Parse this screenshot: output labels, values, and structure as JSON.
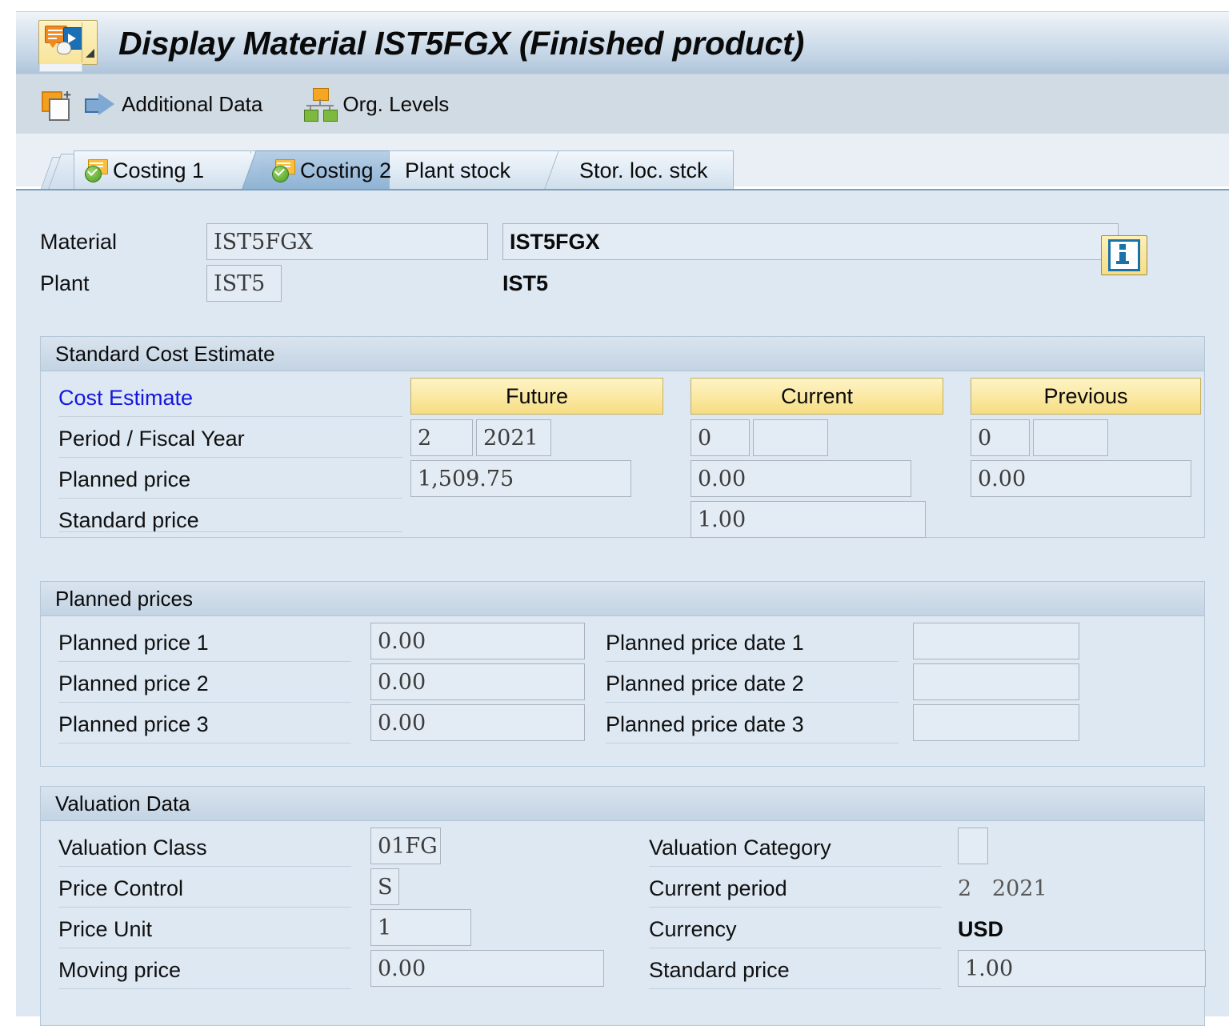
{
  "window": {
    "title": "Display Material IST5FGX (Finished product)",
    "title_icon": "material-display-icon"
  },
  "toolbar": {
    "items": [
      {
        "label": "Additional Data",
        "icon": "additional-data-icon"
      },
      {
        "label": "Org. Levels",
        "icon": "org-levels-icon"
      }
    ]
  },
  "tabs": [
    {
      "label": "Costing 1",
      "active": false,
      "icon": "costing-tab-icon"
    },
    {
      "label": "Costing 2",
      "active": true,
      "icon": "costing-tab-icon"
    },
    {
      "label": "Plant stock",
      "active": false,
      "icon": ""
    },
    {
      "label": "Stor. loc. stck",
      "active": false,
      "icon": ""
    }
  ],
  "header": {
    "material_label": "Material",
    "material_key": "IST5FGX",
    "material_desc": "IST5FGX",
    "plant_label": "Plant",
    "plant_key": "IST5",
    "plant_desc": "IST5",
    "info_icon": "info-icon"
  },
  "standard_cost_estimate": {
    "title": "Standard Cost Estimate",
    "cost_estimate_label": "Cost Estimate",
    "period_label": "Period / Fiscal Year",
    "planned_price_label": "Planned price",
    "standard_price_label": "Standard price",
    "columns": [
      {
        "header": "Future",
        "period": "2",
        "fiscal_year": "2021",
        "planned_price": "1,509.75",
        "standard_price": ""
      },
      {
        "header": "Current",
        "period": "0",
        "fiscal_year": "",
        "planned_price": "0.00",
        "standard_price": "1.00"
      },
      {
        "header": "Previous",
        "period": "0",
        "fiscal_year": "",
        "planned_price": "0.00",
        "standard_price": ""
      }
    ]
  },
  "planned_prices": {
    "title": "Planned prices",
    "rows": [
      {
        "label": "Planned price 1",
        "value": "0.00",
        "date_label": "Planned price date 1",
        "date_value": ""
      },
      {
        "label": "Planned price 2",
        "value": "0.00",
        "date_label": "Planned price date 2",
        "date_value": ""
      },
      {
        "label": "Planned price 3",
        "value": "0.00",
        "date_label": "Planned price date 3",
        "date_value": ""
      }
    ]
  },
  "valuation_data": {
    "title": "Valuation Data",
    "left": [
      {
        "label": "Valuation Class",
        "value": "01FG"
      },
      {
        "label": "Price Control",
        "value": "S"
      },
      {
        "label": "Price Unit",
        "value": "1"
      },
      {
        "label": "Moving price",
        "value": "0.00"
      }
    ],
    "right": [
      {
        "label": "Valuation Category",
        "value": ""
      },
      {
        "label": "Current period",
        "value": "2   2021"
      },
      {
        "label": "Currency",
        "value": "USD"
      },
      {
        "label": "Standard price",
        "value": "1.00"
      }
    ]
  },
  "colors": {
    "title_bar_top": "#f1f5f9",
    "title_bar_bottom": "#aec4da",
    "toolbar_bg": "#d1dbe4",
    "content_bg": "#dde8f2",
    "field_bg": "#e3ecf4",
    "accent_yellow": "#f6dd83",
    "link_blue": "#1515e0",
    "active_tab": "#8fb3d4"
  }
}
